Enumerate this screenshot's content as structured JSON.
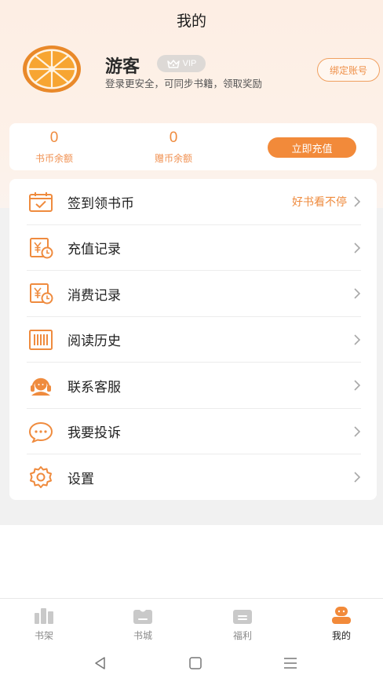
{
  "header": {
    "title": "我的"
  },
  "profile": {
    "nickname": "游客",
    "vip_label": "VIP",
    "tagline": "登录更安全，可同步书籍，领取奖励",
    "bind_label": "绑定账号"
  },
  "balance": {
    "coins_value": "0",
    "coins_label": "书币余额",
    "gift_value": "0",
    "gift_label": "赠币余额",
    "recharge_label": "立即充值"
  },
  "menu": [
    {
      "label": "签到领书币",
      "hint": "好书看不停",
      "icon": "calendar-check-icon"
    },
    {
      "label": "充值记录",
      "hint": "",
      "icon": "yen-clock-icon"
    },
    {
      "label": "消费记录",
      "hint": "",
      "icon": "yen-clock-icon"
    },
    {
      "label": "阅读历史",
      "hint": "",
      "icon": "book-stack-icon"
    },
    {
      "label": "联系客服",
      "hint": "",
      "icon": "headset-icon"
    },
    {
      "label": "我要投诉",
      "hint": "",
      "icon": "chat-bubble-icon"
    },
    {
      "label": "设置",
      "hint": "",
      "icon": "gear-icon"
    }
  ],
  "tabs": [
    {
      "label": "书架",
      "icon": "bookshelf-icon",
      "active": false
    },
    {
      "label": "书城",
      "icon": "store-icon",
      "active": false
    },
    {
      "label": "福利",
      "icon": "gift-icon",
      "active": false
    },
    {
      "label": "我的",
      "icon": "profile-icon",
      "active": true
    }
  ],
  "colors": {
    "accent": "#f28a3a",
    "inactive": "#c9c9c9"
  }
}
